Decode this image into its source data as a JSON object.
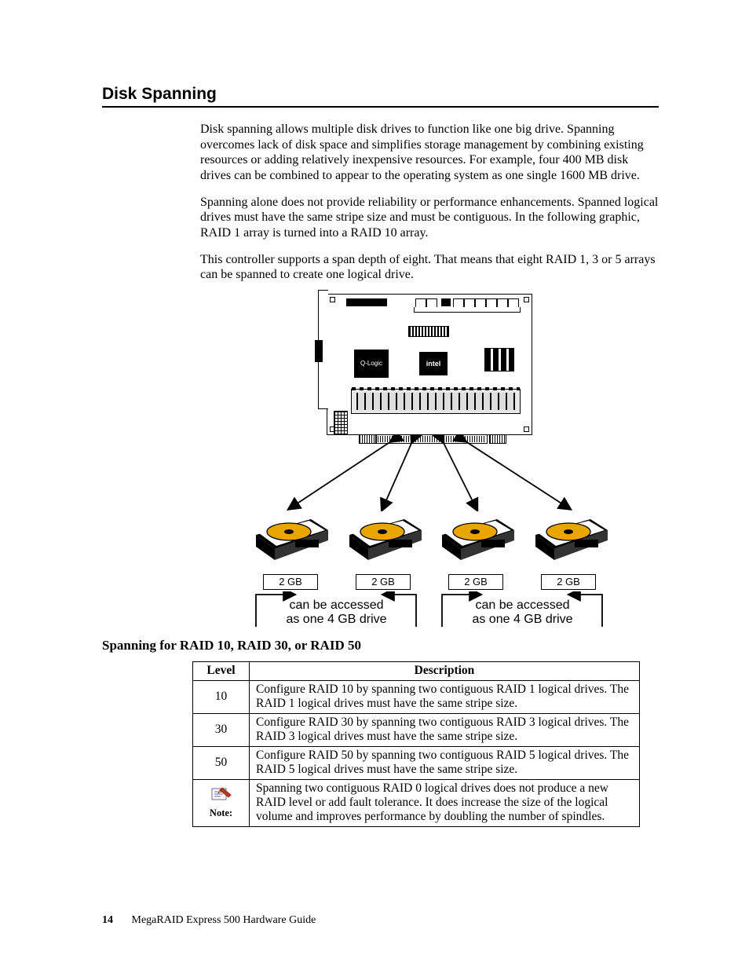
{
  "section_title": "Disk Spanning",
  "paragraphs": {
    "p1": "Disk spanning allows multiple disk drives to function like one big drive. Spanning overcomes lack of disk space and simplifies storage management by combining existing resources or adding relatively inexpensive resources. For example, four 400 MB disk drives can be combined to appear to the operating system as one single 1600 MB drive.",
    "p2": "Spanning alone does not provide reliability or performance enhancements. Spanned logical drives must have the same stripe size and must be contiguous. In the following graphic, RAID 1 array is turned into a RAID 10 array.",
    "p3": "This controller supports a span depth of eight. That means that eight RAID 1, 3 or 5 arrays can be spanned to create one logical drive."
  },
  "diagram": {
    "chip1": "Q-Logic",
    "chip2": "intel",
    "drive_caps": [
      "2 GB",
      "2 GB",
      "2 GB",
      "2 GB"
    ],
    "span_text_line1": "can be accessed",
    "span_text_line2": "as one 4 GB drive"
  },
  "subhead": "Spanning for RAID 10, RAID 30, or RAID 50",
  "table": {
    "headers": {
      "level": "Level",
      "desc": "Description"
    },
    "rows": [
      {
        "level": "10",
        "desc": "Configure RAID 10 by spanning two contiguous RAID 1 logical drives. The RAID 1 logical drives must have the same stripe size."
      },
      {
        "level": "30",
        "desc": "Configure RAID 30 by spanning two contiguous RAID 3 logical drives. The RAID 3 logical drives must have the same stripe size."
      },
      {
        "level": "50",
        "desc": "Configure RAID 50 by spanning two contiguous RAID 5 logical drives. The RAID 5 logical drives must have the same stripe size."
      }
    ],
    "note_label": "Note:",
    "note_desc": "Spanning two contiguous RAID 0 logical drives does not produce a new RAID level or add fault tolerance. It does increase the size of the logical volume and improves performance by doubling the number of spindles."
  },
  "footer": {
    "page_num": "14",
    "doc_title": "MegaRAID Express 500 Hardware Guide"
  }
}
